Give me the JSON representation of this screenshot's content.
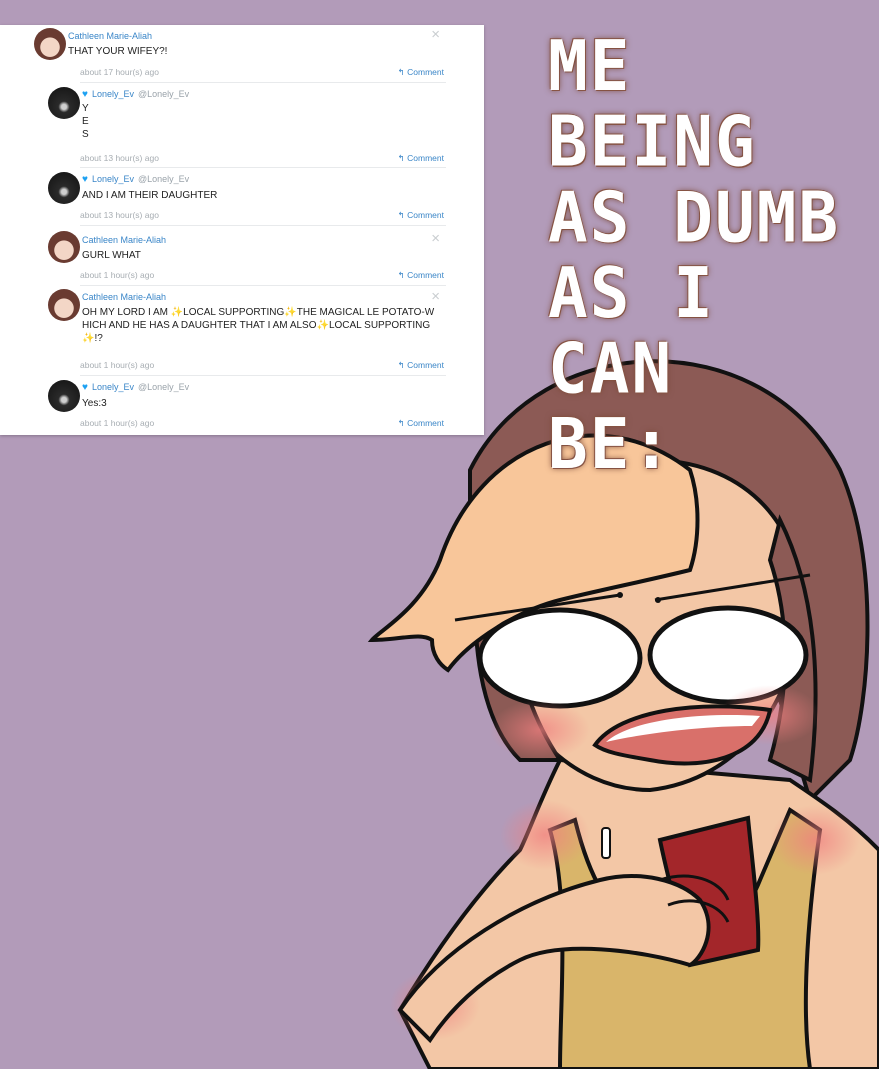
{
  "comments": [
    {
      "author": "Cathleen Marie-Aliah",
      "handle": "",
      "text": "THAT YOUR WIFEY?!",
      "time": "about 17 hour(s) ago",
      "reply_label": "↰ Comment",
      "avatar": "cathleen"
    },
    {
      "author": "Lonely_Ev",
      "handle": "@Lonely_Ev",
      "text": "Y\nE\nS",
      "time": "about 13 hour(s) ago",
      "reply_label": "↰ Comment",
      "avatar": "lonely"
    },
    {
      "author": "Lonely_Ev",
      "handle": "@Lonely_Ev",
      "text": "AND I AM THEIR DAUGHTER",
      "time": "about 13 hour(s) ago",
      "reply_label": "↰ Comment",
      "avatar": "lonely"
    },
    {
      "author": "Cathleen Marie-Aliah",
      "handle": "",
      "text": "GURL WHAT",
      "time": "about 1 hour(s) ago",
      "reply_label": "↰ Comment",
      "avatar": "cathleen"
    },
    {
      "author": "Cathleen Marie-Aliah",
      "handle": "",
      "text": "OH MY LORD I AM ✨LOCAL SUPPORTING✨THE MAGICAL LE POTATO-W\nHICH AND HE HAS A DAUGHTER THAT I AM ALSO✨LOCAL SUPPORTING\n✨!?",
      "time": "about 1 hour(s) ago",
      "reply_label": "↰ Comment",
      "avatar": "cathleen"
    },
    {
      "author": "Lonely_Ev",
      "handle": "@Lonely_Ev",
      "text": "Yes:3",
      "time": "about 1 hour(s) ago",
      "reply_label": "↰ Comment",
      "avatar": "lonely"
    }
  ],
  "caption": "ME BEING\nAS DUMB\nAS I CAN\nBE:",
  "colors": {
    "background": "#b29bb9",
    "link": "#3a86c8",
    "hair": "#8c5a55",
    "bangs": "#f8c69a",
    "skin": "#f3c7a6",
    "shirt": "#d9b56a",
    "phone": "#a3262a"
  }
}
